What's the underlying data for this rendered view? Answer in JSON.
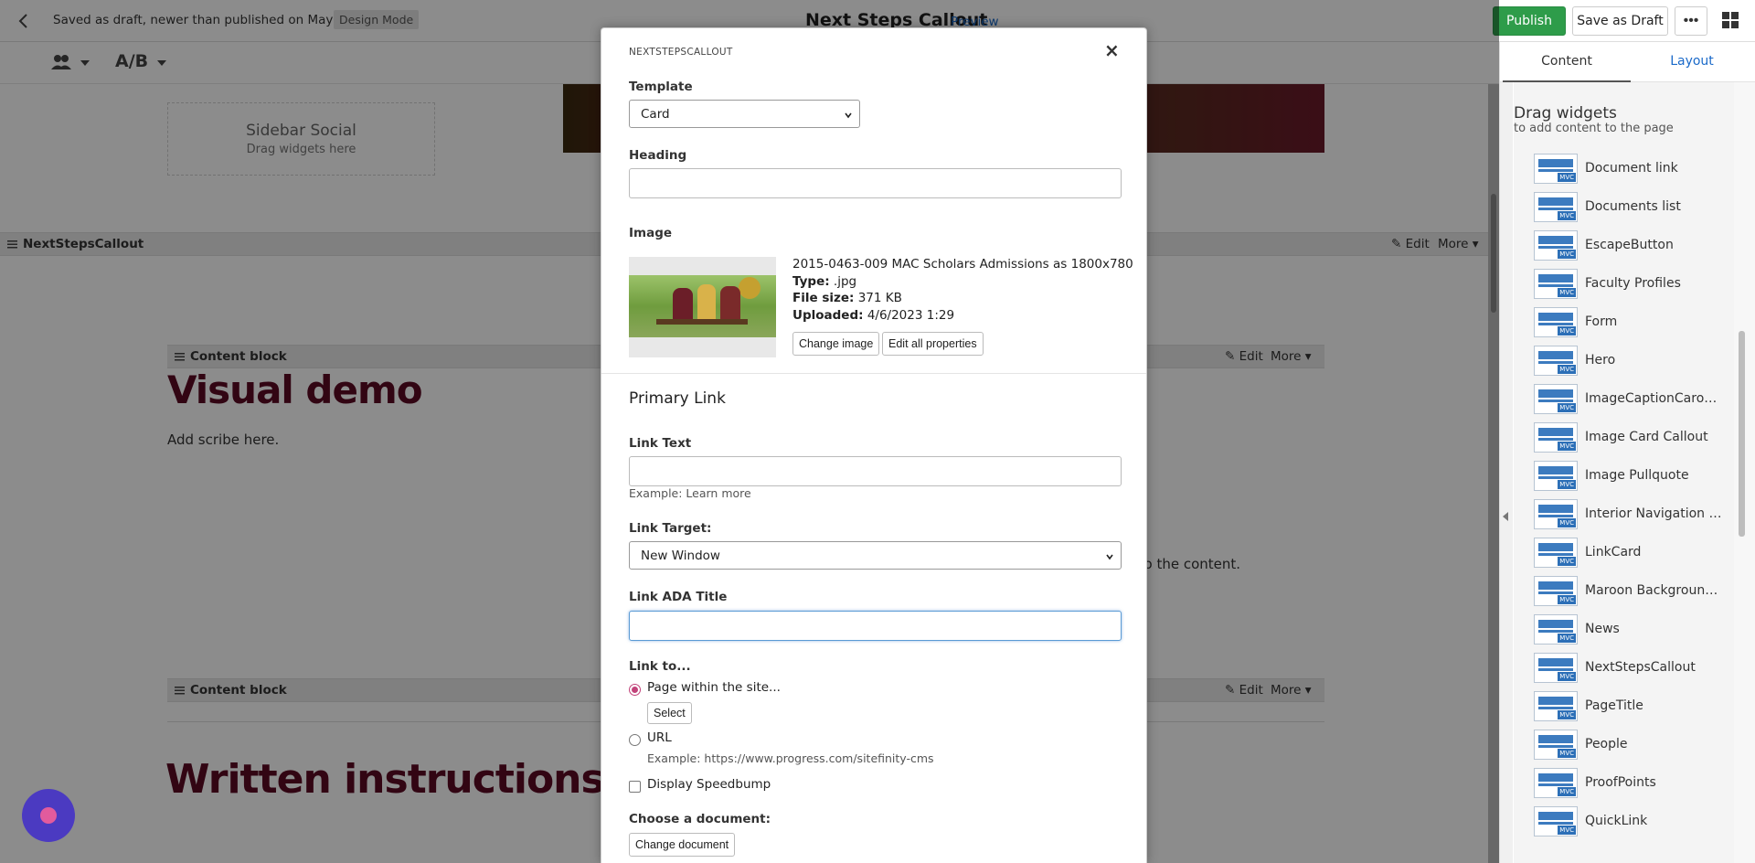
{
  "topbar": {
    "draft_status": "Saved as draft, newer than published on May 24",
    "design_mode": "Design Mode",
    "page_title": "Next Steps Callout",
    "preview": "Preview",
    "publish": "Publish",
    "save_draft": "Save as Draft",
    "more": "•••"
  },
  "toolbar": {
    "ab": "A/B"
  },
  "canvas": {
    "sidebar_social_title": "Sidebar Social",
    "sidebar_social_hint": "Drag widgets here",
    "widget1_label": "NextStepsCallout",
    "widget2_label": "Content block",
    "widget3_label": "Content block",
    "edit": "Edit",
    "more": "More",
    "visual_demo": "Visual demo",
    "add_scribe": "Add scribe here.",
    "content_fragment": "t to the content.",
    "written_instructions": "Written instructions"
  },
  "panel": {
    "tab_content": "Content",
    "tab_layout": "Layout",
    "drag_title": "Drag widgets",
    "drag_sub": "to add content to the page",
    "mvc": "MVC",
    "widgets": [
      "Document link",
      "Documents list",
      "EscapeButton",
      "Faculty Profiles",
      "Form",
      "Hero",
      "ImageCaptionCarousel",
      "Image Card Callout",
      "Image Pullquote",
      "Interior Navigation C...",
      "LinkCard",
      "Maroon Background ...",
      "News",
      "NextStepsCallout",
      "PageTitle",
      "People",
      "ProofPoints",
      "QuickLink"
    ]
  },
  "modal": {
    "title": "NEXTSTEPSCALLOUT",
    "close": "×",
    "template_label": "Template",
    "template_value": "Card",
    "heading_label": "Heading",
    "heading_value": "",
    "image_label": "Image",
    "image_name": "2015-0463-009 MAC Scholars Admissions as 1800x780",
    "type_label": "Type:",
    "type_value": " .jpg",
    "size_label": "File size:",
    "size_value": " 371 KB",
    "uploaded_label": "Uploaded:",
    "uploaded_value": " 4/6/2023 1:29",
    "change_image": "Change image",
    "edit_props": "Edit all properties",
    "primary_link": "Primary Link",
    "link_text_label": "Link Text",
    "link_text_value": "",
    "link_text_hint": "Example: Learn more",
    "link_target_label": "Link Target:",
    "link_target_value": "New Window",
    "ada_label": "Link ADA Title",
    "ada_value": "",
    "link_to_label": "Link to...",
    "page_option": "Page within the site...",
    "select_btn": "Select",
    "url_option": "URL",
    "url_hint": "Example: https://www.progress.com/sitefinity-cms",
    "speedbump": "Display Speedbump",
    "doc_label": "Choose a document:",
    "change_doc": "Change document"
  }
}
